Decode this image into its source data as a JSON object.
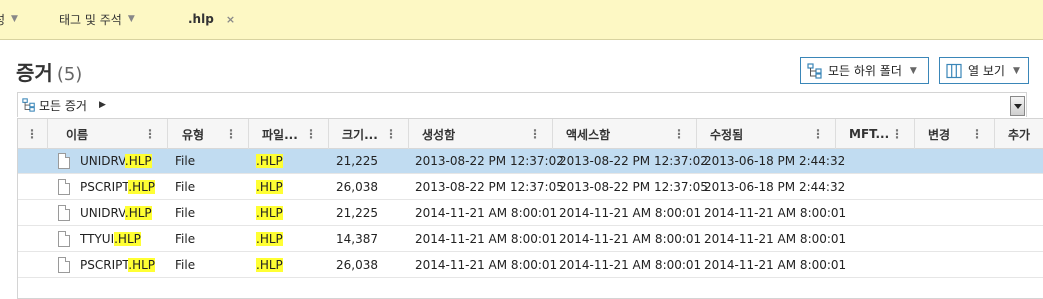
{
  "tabs": [
    {
      "label": "성",
      "caret": "▼",
      "active": false
    },
    {
      "label": "태그 및 주석",
      "caret": "▼",
      "active": false
    },
    {
      "label": ".hlp",
      "close": "×",
      "active": true
    }
  ],
  "page": {
    "title": "증거",
    "count": "(5)"
  },
  "buttons": {
    "subfolders": {
      "label": "모든 하위 폴더",
      "caret": "▼",
      "icon": "folder-tree-icon"
    },
    "columns": {
      "label": "열 보기",
      "caret": "▼",
      "icon": "columns-icon"
    }
  },
  "breadcrumb": {
    "label": "모든 증거",
    "arrow": "▶",
    "icon": "folder-tree-icon"
  },
  "columns": [
    "이름",
    "유형",
    "파일...",
    "크기...",
    "생성함",
    "액세스함",
    "수정됨",
    "MFT...",
    "변경",
    "추가"
  ],
  "highlight_color": "#ffff33",
  "selected_color": "#c1dcf1",
  "rows": [
    {
      "name_prefix": "UNIDRV",
      "name_match": ".HLP",
      "type": "File",
      "ext": ".HLP",
      "size": "21,225",
      "created": "2013-08-22 PM 12:37:02",
      "accessed": "2013-08-22 PM 12:37:02",
      "modified": "2013-06-18 PM 2:44:32",
      "selected": true
    },
    {
      "name_prefix": "PSCRIPT",
      "name_match": ".HLP",
      "type": "File",
      "ext": ".HLP",
      "size": "26,038",
      "created": "2013-08-22 PM 12:37:05",
      "accessed": "2013-08-22 PM 12:37:05",
      "modified": "2013-06-18 PM 2:44:32",
      "selected": false
    },
    {
      "name_prefix": "UNIDRV",
      "name_match": ".HLP",
      "type": "File",
      "ext": ".HLP",
      "size": "21,225",
      "created": "2014-11-21 AM 8:00:01",
      "accessed": "2014-11-21 AM 8:00:01",
      "modified": "2014-11-21 AM 8:00:01",
      "selected": false
    },
    {
      "name_prefix": "TTYUI",
      "name_match": ".HLP",
      "type": "File",
      "ext": ".HLP",
      "size": "14,387",
      "created": "2014-11-21 AM 8:00:01",
      "accessed": "2014-11-21 AM 8:00:01",
      "modified": "2014-11-21 AM 8:00:01",
      "selected": false
    },
    {
      "name_prefix": "PSCRIPT",
      "name_match": ".HLP",
      "type": "File",
      "ext": ".HLP",
      "size": "26,038",
      "created": "2014-11-21 AM 8:00:01",
      "accessed": "2014-11-21 AM 8:00:01",
      "modified": "2014-11-21 AM 8:00:01",
      "selected": false
    }
  ]
}
